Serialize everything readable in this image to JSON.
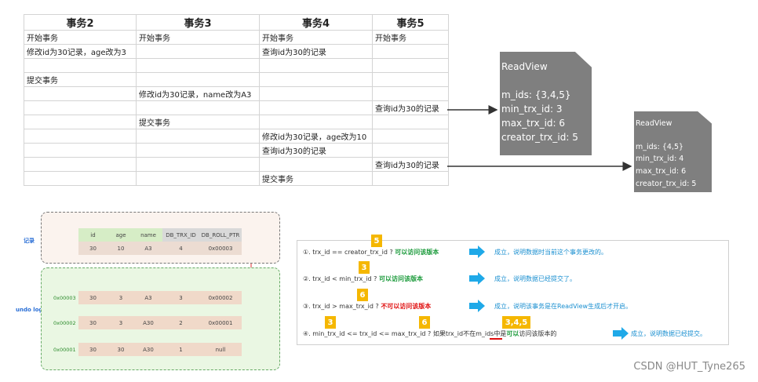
{
  "table": {
    "headers": [
      "事务2",
      "事务3",
      "事务4",
      "事务5"
    ],
    "rows": [
      [
        "开始事务",
        "开始事务",
        "开始事务",
        "开始事务"
      ],
      [
        "修改id为30记录，age改为3",
        "",
        "查询id为30的记录",
        ""
      ],
      [
        "",
        "",
        "",
        ""
      ],
      [
        "提交事务",
        "",
        "",
        ""
      ],
      [
        "",
        "修改id为30记录，name改为A3",
        "",
        ""
      ],
      [
        "",
        "",
        "",
        "查询id为30的记录"
      ],
      [
        "",
        "提交事务",
        "",
        ""
      ],
      [
        "",
        "",
        "修改id为30记录，age改为10",
        ""
      ],
      [
        "",
        "",
        "查询id为30的记录",
        ""
      ],
      [
        "",
        "",
        "",
        "查询id为30的记录"
      ],
      [
        "",
        "",
        "提交事务",
        ""
      ]
    ]
  },
  "readview1": {
    "title": "ReadView",
    "m_ids": "m_ids: {3,4,5}",
    "min": "min_trx_id: 3",
    "max": "max_trx_id: 6",
    "creator": "creator_trx_id: 5"
  },
  "readview2": {
    "title": "ReadView",
    "m_ids": "m_ids: {4,5}",
    "min": "min_trx_id: 4",
    "max": "max_trx_id: 6",
    "creator": "creator_trx_id: 5"
  },
  "undo": {
    "record_label": "记录",
    "undo_label": "undo log",
    "columns": [
      "id",
      "age",
      "name",
      "DB_TRX_ID",
      "DB_ROLL_PTR"
    ],
    "current": [
      "30",
      "10",
      "A3",
      "4",
      "0x00003"
    ],
    "versions": [
      {
        "addr": "0x00003",
        "cells": [
          "30",
          "3",
          "A3",
          "3",
          "0x00002"
        ]
      },
      {
        "addr": "0x00002",
        "cells": [
          "30",
          "3",
          "A30",
          "2",
          "0x00001"
        ]
      },
      {
        "addr": "0x00001",
        "cells": [
          "30",
          "30",
          "A30",
          "1",
          "null"
        ]
      }
    ]
  },
  "rules": {
    "r1": {
      "text": "①. trx_id  == creator_trx_id ?",
      "verdict": "可以访问该版本",
      "tag": "5",
      "result": "成立，说明数据时当前这个事务更改的。"
    },
    "r2": {
      "text": "②. trx_id < min_trx_id ?",
      "verdict": "可以访问该版本",
      "tag": "3",
      "result": "成立，说明数据已经提交了。"
    },
    "r3": {
      "text": "③. trx_id > max_trx_id ?",
      "verdict": "不可以访问该版本",
      "tag": "6",
      "result": "成立，说明该事务是在ReadView生成后才开启。"
    },
    "r4": {
      "text_a": "④. min_trx_id <= trx_id <= max_trx_id ?  如果trx_id",
      "text_not": "不在",
      "text_b": "m_ids中是",
      "text_ok": "可以",
      "text_c": "访问该版本的",
      "tag_a": "3",
      "tag_b": "6",
      "tag_c": "3,4,5",
      "result": "成立，说明数据已经提交。"
    }
  },
  "watermark": "CSDN @HUT_Tyne265"
}
